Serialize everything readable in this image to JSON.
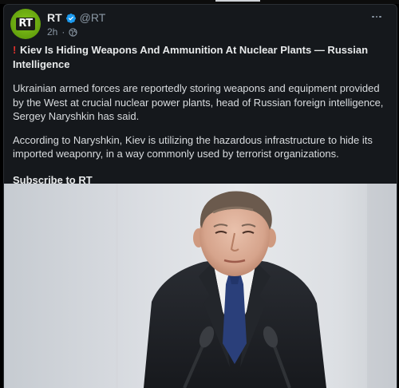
{
  "account": {
    "display_name": "RT",
    "handle": "@RT",
    "timestamp": "2h",
    "avatar_mark": "RT"
  },
  "post": {
    "alert_icon": "!",
    "headline": "Kiev Is Hiding Weapons And Ammunition At Nuclear Plants — Russian Intelligence",
    "paragraphs": [
      "Ukrainian armed forces are reportedly storing weapons and equipment provided by the West at crucial nuclear power plants, head of Russian foreign intelligence, Sergey Naryshkin has said.",
      "According to Naryshkin, Kiev is utilizing the hazardous infrastructure to hide its imported weaponry, in a way commonly used by terrorist organizations."
    ],
    "subscribe_label": "Subscribe to RT"
  },
  "colors": {
    "card_background": "#15181c",
    "verified_badge": "#1d9bf0",
    "avatar_green": "#6aa80f",
    "alert_red": "#e0322d",
    "muted_text": "#8b98a5"
  },
  "icons": {
    "verified": "verified-badge-icon",
    "globe": "globe-icon",
    "more": "more-options-icon",
    "alert": "exclamation-icon"
  }
}
